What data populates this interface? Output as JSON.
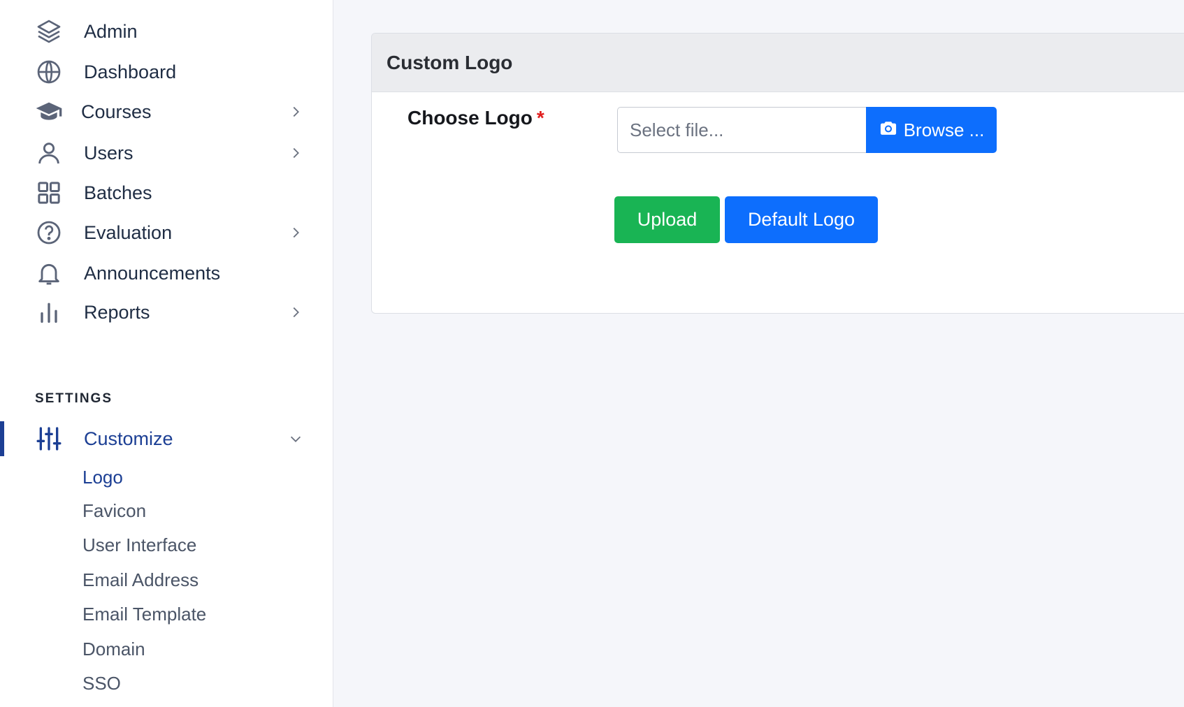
{
  "sidebar": {
    "items": [
      {
        "label": "Admin",
        "icon": "layers-icon",
        "has_submenu": false
      },
      {
        "label": "Dashboard",
        "icon": "globe-icon",
        "has_submenu": false
      },
      {
        "label": "Courses",
        "icon": "graduation-cap-icon",
        "has_submenu": true
      },
      {
        "label": "Users",
        "icon": "user-icon",
        "has_submenu": true
      },
      {
        "label": "Batches",
        "icon": "grid-icon",
        "has_submenu": false
      },
      {
        "label": "Evaluation",
        "icon": "question-circle-icon",
        "has_submenu": true
      },
      {
        "label": "Announcements",
        "icon": "bell-icon",
        "has_submenu": false
      },
      {
        "label": "Reports",
        "icon": "bar-chart-icon",
        "has_submenu": true
      }
    ],
    "settings_title": "SETTINGS",
    "customize": {
      "label": "Customize",
      "icon": "sliders-icon",
      "expanded": true,
      "subitems": [
        {
          "label": "Logo",
          "active": true
        },
        {
          "label": "Favicon",
          "active": false
        },
        {
          "label": "User Interface",
          "active": false
        },
        {
          "label": "Email Address",
          "active": false
        },
        {
          "label": "Email Template",
          "active": false
        },
        {
          "label": "Domain",
          "active": false
        },
        {
          "label": "SSO",
          "active": false
        }
      ]
    }
  },
  "main": {
    "card_title": "Custom Logo",
    "choose_label": "Choose Logo",
    "required_mark": "*",
    "file_placeholder": "Select file...",
    "browse_label": "Browse ...",
    "browse_icon": "camera-icon",
    "upload_label": "Upload",
    "default_logo_label": "Default Logo"
  },
  "colors": {
    "primary": "#0d6efd",
    "success": "#19b454",
    "active_nav": "#1c3f94",
    "required": "#e11d1d"
  }
}
